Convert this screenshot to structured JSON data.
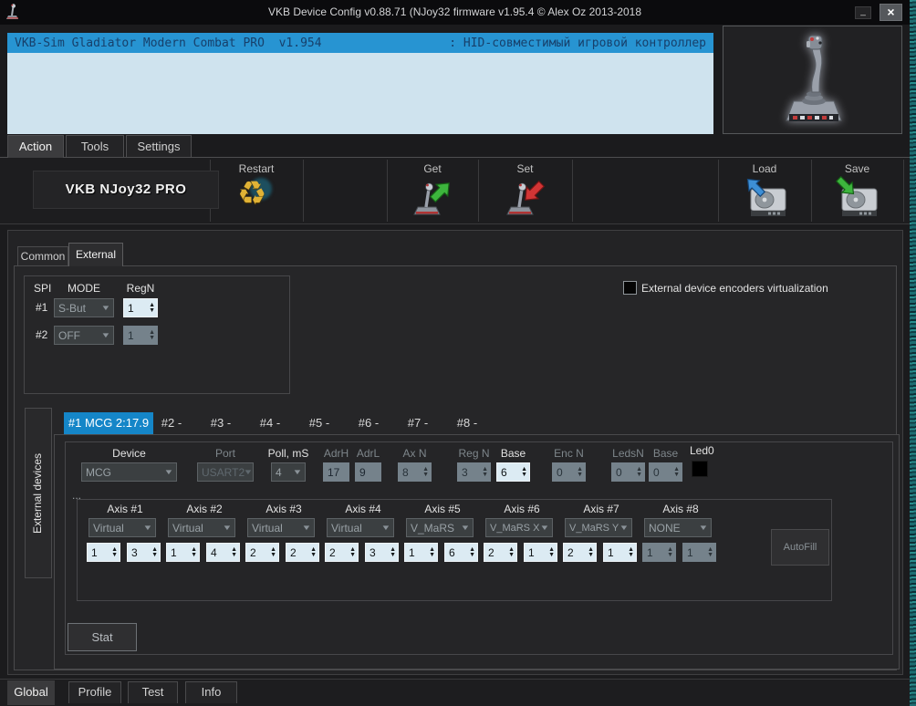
{
  "window": {
    "title": "VKB Device Config v0.88.71 (NJoy32 firmware v1.95.4 © Alex Oz 2013-2018",
    "minimize_label": "_",
    "close_label": "×"
  },
  "device_info": {
    "model": "VKB-Sim Gladiator Modern Combat PRO  v1.954",
    "hid_label": ": HID-совместимый игровой контроллер"
  },
  "menu": {
    "tabs": [
      {
        "label": "Action"
      },
      {
        "label": "Tools"
      },
      {
        "label": "Settings"
      }
    ]
  },
  "toolbar": {
    "device_name": "VKB NJoy32 PRO",
    "restart_label": "Restart",
    "get_label": "Get",
    "set_label": "Set",
    "load_label": "Load",
    "save_label": "Save"
  },
  "content": {
    "tabs": {
      "common": "Common",
      "external": "External"
    },
    "spi": {
      "col_spi": "SPI",
      "col_mode": "MODE",
      "col_regn": "RegN",
      "rows": [
        {
          "id": "#1",
          "mode": "S-But",
          "regn": "1"
        },
        {
          "id": "#2",
          "mode": "OFF",
          "regn": "1"
        }
      ]
    },
    "virtualization_label": "External device encoders virtualization",
    "side_tab_label": "External devices",
    "device_tabs": [
      "#1 MCG 2:17.9",
      "#2 -",
      "#3 -",
      "#4 -",
      "#5 -",
      "#6 -",
      "#7 -",
      "#8 -"
    ],
    "device": {
      "device_label": "Device",
      "device_value": "MCG",
      "port_label": "Port",
      "port_value": "USART2",
      "poll_label": "Poll, mS",
      "poll_value": "4",
      "adrh_label": "AdrH",
      "adrh_value": "17",
      "adrl_label": "AdrL",
      "adrl_value": "9",
      "axn_label": "Ax N",
      "axn_value": "8",
      "regn_label": "Reg N",
      "regn_value": "3",
      "base_label": "Base",
      "base_value": "6",
      "encn_label": "Enc N",
      "encn_value": "0",
      "ledsn_label": "LedsN",
      "ledsn_value": "0",
      "base2_label": "Base",
      "base2_value": "0",
      "led0_label": "Led0"
    },
    "axes_group_label": "...",
    "axes": [
      {
        "label": "Axis #1",
        "mode": "Virtual",
        "a": "1",
        "b": "3"
      },
      {
        "label": "Axis #2",
        "mode": "Virtual",
        "a": "1",
        "b": "4"
      },
      {
        "label": "Axis #3",
        "mode": "Virtual",
        "a": "2",
        "b": "2"
      },
      {
        "label": "Axis #4",
        "mode": "Virtual",
        "a": "2",
        "b": "3"
      },
      {
        "label": "Axis #5",
        "mode": "V_MaRS",
        "a": "1",
        "b": "6"
      },
      {
        "label": "Axis #6",
        "mode": "V_MaRS X",
        "a": "2",
        "b": "1"
      },
      {
        "label": "Axis #7",
        "mode": "V_MaRS Y",
        "a": "2",
        "b": "1"
      },
      {
        "label": "Axis #8",
        "mode": "NONE",
        "a": "1",
        "b": "1"
      }
    ],
    "autofill_label": "AutoFill",
    "stat_label": "Stat"
  },
  "footer": {
    "tabs": [
      "Global",
      "Profile",
      "Test",
      "Info"
    ]
  },
  "colors": {
    "accent_blue": "#2794d2",
    "active_tab_blue": "#1586c8",
    "info_bg": "#cfe3ee",
    "spinner_enabled_bg": "#dcebf3",
    "spinner_disabled_bg": "#75828b"
  }
}
